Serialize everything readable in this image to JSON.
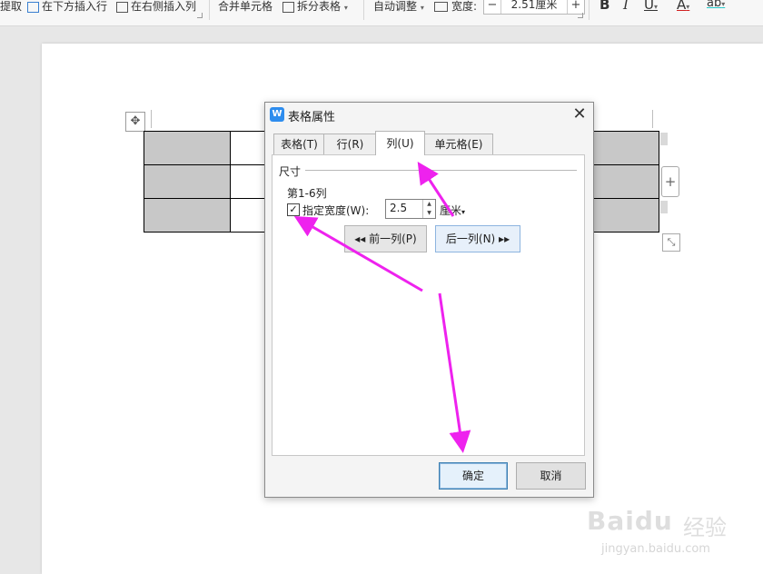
{
  "ribbon": {
    "extract_label": "提取",
    "insert_below_label": "在下方插入行",
    "insert_right_label": "在右侧插入列",
    "merge_cells_label": "合并单元格",
    "split_cells_label": "拆分表格",
    "auto_adjust_label": "自动调整",
    "width_label": "宽度:",
    "width_value": "2.51厘米",
    "minus": "−",
    "plus": "+",
    "bold": "B",
    "italic": "I",
    "underline": "U",
    "font_color": "A",
    "highlight": "ab"
  },
  "dialog": {
    "title": "表格属性",
    "app_icon": "W",
    "close": "✕",
    "tabs": [
      {
        "label": "表格(T)"
      },
      {
        "label": "行(R)"
      },
      {
        "label": "列(U)"
      },
      {
        "label": "单元格(E)"
      }
    ],
    "active_tab": "列(U)",
    "section_title": "尺寸",
    "columns_label": "第1-6列",
    "specify_width_label": "指定宽度(W):",
    "specify_width_checked": true,
    "width_value": "2.5",
    "unit_label": "厘米",
    "prev_column_label": "◂◂ 前一列(P)",
    "next_column_label": "后一列(N) ▸▸",
    "ok_label": "确定",
    "cancel_label": "取消"
  },
  "watermark": {
    "logo": "Baidu",
    "cn": "经验",
    "url": "jingyan.baidu.com"
  },
  "colors": {
    "annotation_arrow": "#ee22ee",
    "cell_grey": "#c8c8c8",
    "accent": "#2e8dee"
  },
  "icons": {
    "move_handle": "move-icon",
    "add_column": "plus-icon",
    "resize": "resize-icon"
  }
}
